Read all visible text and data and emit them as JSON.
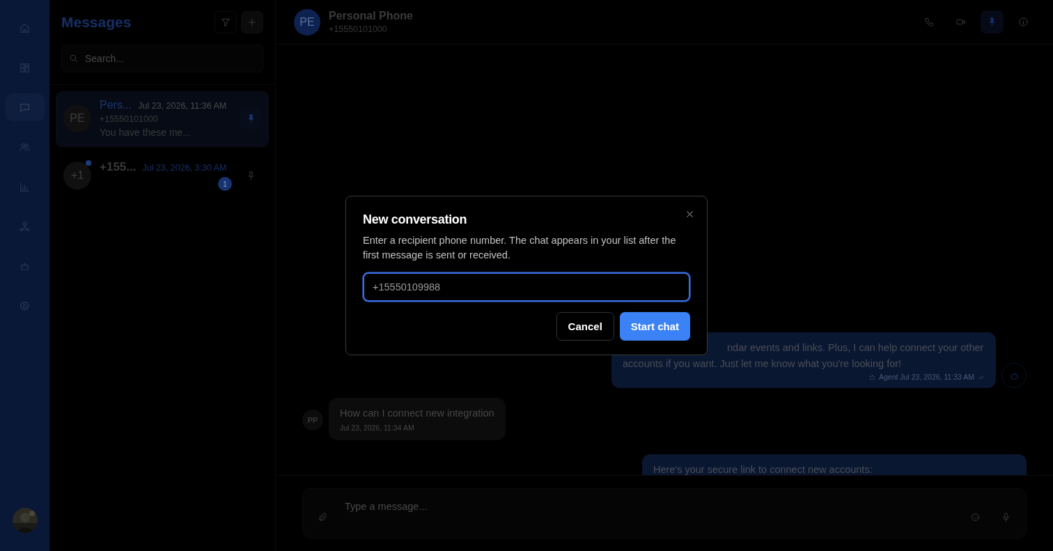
{
  "rail": {
    "items": [
      {
        "kind": "home",
        "selected": false
      },
      {
        "kind": "grid",
        "selected": false
      },
      {
        "kind": "chat",
        "selected": true
      },
      {
        "kind": "people",
        "selected": false
      },
      {
        "kind": "chart",
        "selected": false
      },
      {
        "kind": "network",
        "selected": false
      },
      {
        "kind": "bot",
        "selected": false
      },
      {
        "kind": "settings",
        "selected": false
      }
    ]
  },
  "sidebar": {
    "title": "Messages",
    "search": {
      "placeholder": "Search..."
    },
    "conversations": [
      {
        "initials": "PE",
        "name": "Pers...",
        "time": "Jul 23, 2026, 11:36 AM",
        "phone": "+15550101000",
        "preview": "You have these me...",
        "selected": true,
        "pinned": true,
        "unread": false
      },
      {
        "initials": "+1",
        "name": "+155...",
        "time": "Jul 23, 2026, 3:30 AM",
        "unread_count": "1",
        "selected": false,
        "pinned": false,
        "unread": true
      }
    ]
  },
  "chat_header": {
    "initials": "PE",
    "name": "Personal Phone",
    "phone": "+15550101000",
    "pinned": true
  },
  "messages": [
    {
      "kind": "agent",
      "lines": [
        "ndar events and links. Plus, I can help connect your other",
        "accounts if you want. Just let me know what you're looking for!"
      ],
      "sender": "Agent",
      "time": "Jul 23, 2026, 11:33 AM"
    },
    {
      "kind": "user",
      "initials": "PP",
      "lines": [
        "How can I connect new integration"
      ],
      "time": "Jul 23, 2026, 11:34 AM"
    },
    {
      "kind": "agent",
      "lines": [
        "Here's your secure link to connect new accounts:"
      ]
    }
  ],
  "composer": {
    "placeholder": "Type a message..."
  },
  "dialog": {
    "title": "New conversation",
    "description": "Enter a recipient phone number. The chat appears in your list after the first message is sent or received.",
    "input": {
      "placeholder": "+15550109988"
    },
    "buttons": [
      {
        "label": "Cancel",
        "kind": "secondary"
      },
      {
        "label": "Start chat",
        "kind": "primary"
      }
    ]
  }
}
